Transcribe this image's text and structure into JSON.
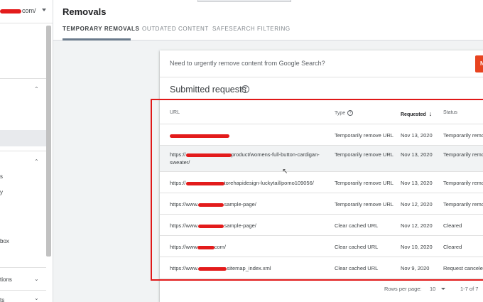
{
  "sidebar": {
    "property_suffix": "com/",
    "labels": [
      "s",
      "y",
      "box",
      "tions",
      "ts"
    ]
  },
  "header": {
    "title": "Removals",
    "tabs": [
      {
        "label": "TEMPORARY REMOVALS"
      },
      {
        "label": "OUTDATED CONTENT"
      },
      {
        "label": "SAFESEARCH FILTERING"
      }
    ]
  },
  "banner": {
    "text": "Need to urgently remove content from Google Search?",
    "button_label": "N"
  },
  "requests": {
    "title": "Submitted requests",
    "help_glyph": "?",
    "columns": {
      "url": "URL",
      "type": "Type",
      "requested": "Requested",
      "status": "Status"
    },
    "rows": [
      {
        "url_prefix": "",
        "url_suffix": "",
        "type": "Temporarily remove URL",
        "requested": "Nov 13, 2020",
        "status": "Temporarily remo"
      },
      {
        "url_prefix": "https://",
        "url_suffix": "product/womens-full-button-cardigan-sweater/",
        "type": "Temporarily remove URL",
        "requested": "Nov 13, 2020",
        "status": "Temporarily remo"
      },
      {
        "url_prefix": "https://",
        "url_suffix": "torehapidesign-luckytail/pomo109056/",
        "type": "Temporarily remove URL",
        "requested": "Nov 13, 2020",
        "status": "Temporarily remo"
      },
      {
        "url_prefix": "https://www.",
        "url_suffix": "sample-page/",
        "type": "Temporarily remove URL",
        "requested": "Nov 12, 2020",
        "status": "Temporarily remo"
      },
      {
        "url_prefix": "https://www.",
        "url_suffix": "sample-page/",
        "type": "Clear cached URL",
        "requested": "Nov 12, 2020",
        "status": "Cleared"
      },
      {
        "url_prefix": "https://www",
        "url_suffix": "com/",
        "type": "Clear cached URL",
        "requested": "Nov 10, 2020",
        "status": "Cleared"
      },
      {
        "url_prefix": "https://www.",
        "url_suffix": "sitemap_index.xml",
        "type": "Clear cached URL",
        "requested": "Nov 9, 2020",
        "status": "Request canceled"
      }
    ],
    "footer": {
      "rows_per_page_label": "Rows per page:",
      "rows_per_page_value": "10",
      "range": "1-7 of 7"
    }
  },
  "colors": {
    "accent": "#e8431f",
    "annotation": "#e01818",
    "redaction": "#e31b1b"
  },
  "icons": [
    "chevron-down-icon",
    "chevron-up-icon",
    "help-icon",
    "sort-arrow-down-icon",
    "pointer-cursor-icon"
  ]
}
